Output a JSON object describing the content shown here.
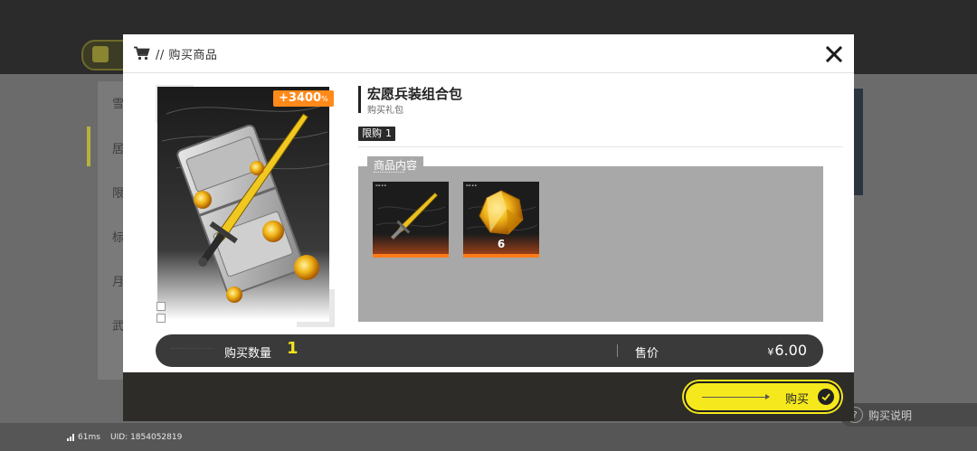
{
  "status": {
    "latency": "61ms",
    "uid": "UID: 1854052819"
  },
  "background": {
    "help_label": "购买说明",
    "help_icon": "question-icon",
    "sidebar_glyphs": [
      "雪",
      "居",
      "限",
      "标",
      "月",
      "武"
    ]
  },
  "modal": {
    "title": "// 购买商品",
    "cart_icon": "cart-icon",
    "close_icon": "close-icon"
  },
  "product": {
    "name": "宏愿兵装组合包",
    "type": "购买礼包",
    "bonus_value": "+3400",
    "bonus_unit": "%",
    "limit_label": "限购",
    "limit_value": "1"
  },
  "contents": {
    "tab_label": "商品内容",
    "items": [
      {
        "name": "sword",
        "quantity": ""
      },
      {
        "name": "golden-crystal",
        "quantity": "6"
      }
    ]
  },
  "purchase": {
    "quantity_label": "购买数量",
    "quantity_value": "1",
    "price_label": "售价",
    "currency": "¥",
    "price": "6.00",
    "buy_label": "购买"
  },
  "colors": {
    "accent_yellow": "#f5e81c",
    "bonus_orange": "#ff8a1a",
    "panel_gray": "#a8a8a8",
    "bar_dark": "#3a3a3a"
  }
}
